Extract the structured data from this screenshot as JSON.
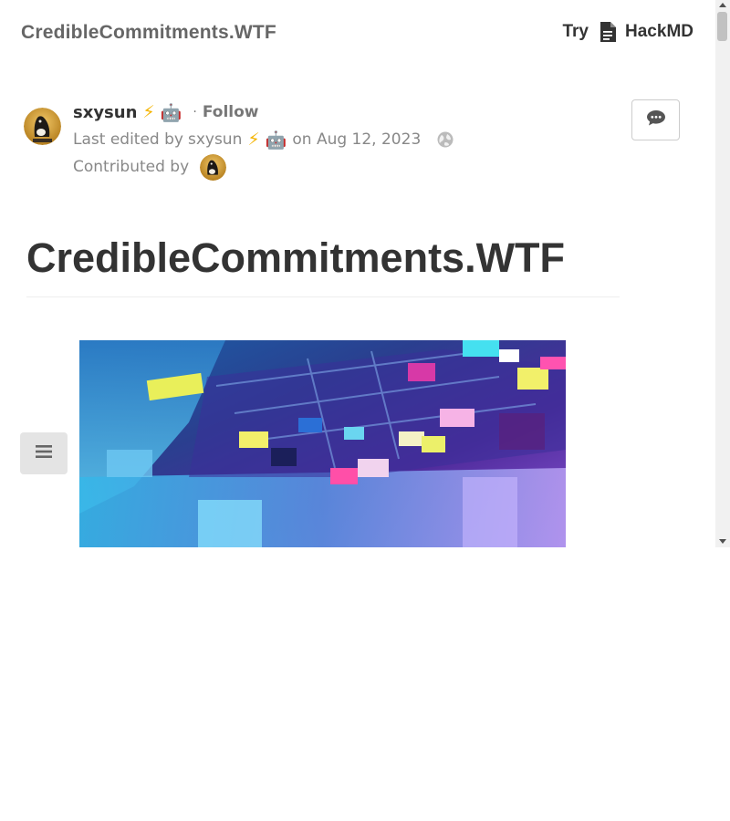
{
  "navbar": {
    "brand": "CredibleCommitments.WTF",
    "try_label": "Try",
    "hackmd_label": "HackMD",
    "icon": "file-text-icon"
  },
  "author": {
    "name": "sxysun",
    "emoji_bolt": "⚡",
    "emoji_robot": "🤖",
    "follow_label": "Follow",
    "last_edited_prefix": "Last edited by",
    "editor_name": "sxysun",
    "date_text": "on Aug 12, 2023",
    "visibility_icon": "globe-icon",
    "contributed_label": "Contributed by"
  },
  "comment_button": {
    "icon": "comment-icon"
  },
  "document": {
    "title": "CredibleCommitments.WTF"
  },
  "toc_button": {
    "icon": "bars-icon"
  },
  "colors": {
    "text_dark": "#333333",
    "text_muted": "#888888",
    "brand_gray": "#666666",
    "toc_bg": "#e4e4e4"
  }
}
